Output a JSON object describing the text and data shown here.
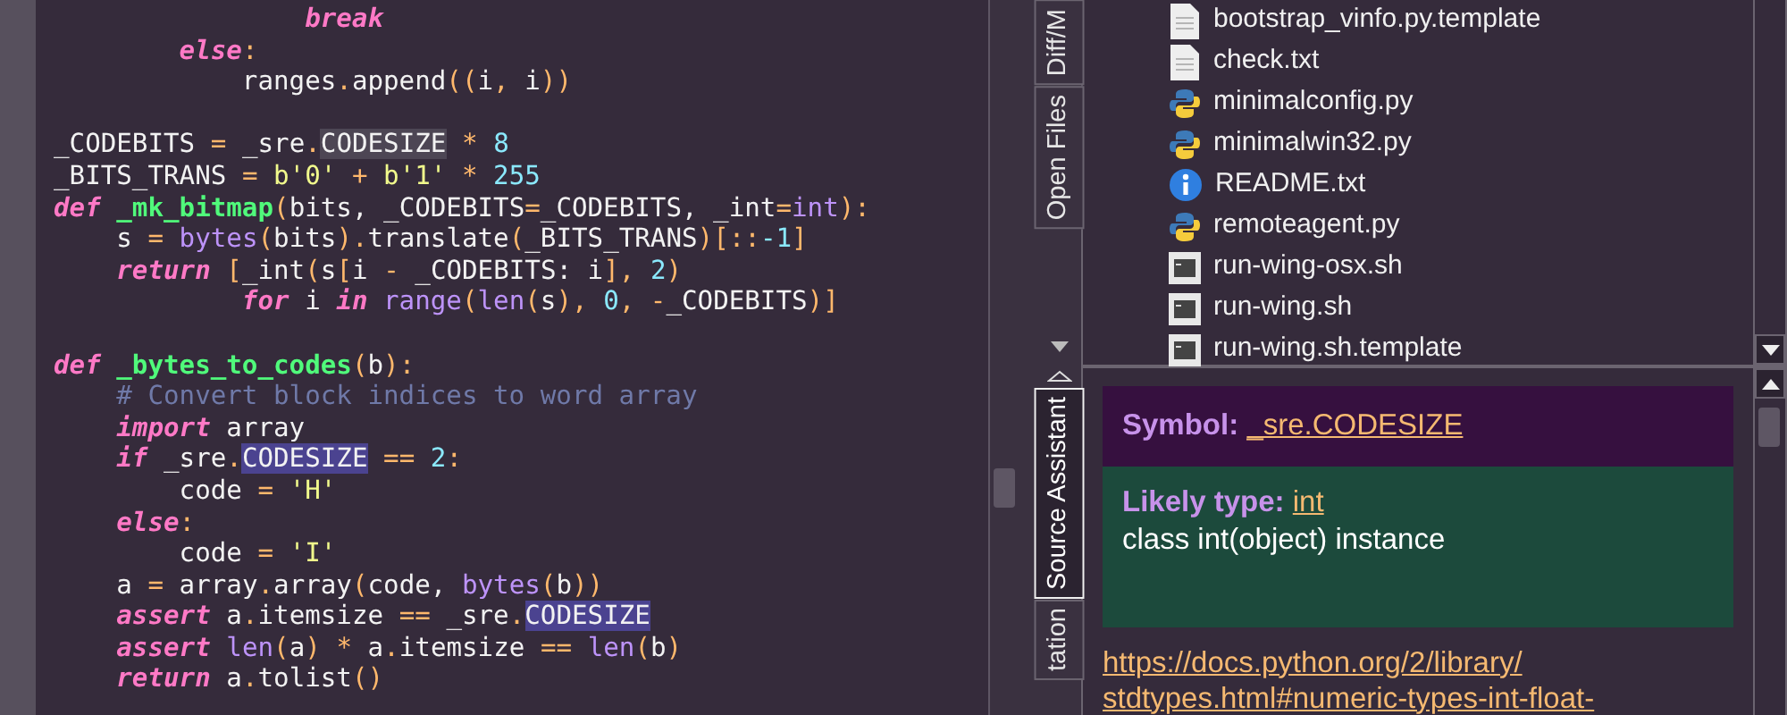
{
  "editor": {
    "blocks": [
      [
        [
          {
            "text": "                break",
            "kind": "keyword"
          }
        ],
        [
          {
            "text": "        else",
            "kind": "keyword"
          },
          {
            "text": ":",
            "kind": "operator"
          }
        ],
        [
          {
            "text": "            ranges",
            "kind": "plain"
          },
          {
            "text": ".",
            "kind": "operator"
          },
          {
            "text": "append",
            "kind": "plain"
          },
          {
            "text": "((",
            "kind": "operator"
          },
          {
            "text": "i",
            "kind": "plain"
          },
          {
            "text": ",",
            "kind": "operator"
          },
          {
            "text": " i",
            "kind": "plain"
          },
          {
            "text": "))",
            "kind": "operator"
          }
        ]
      ],
      [
        [
          {
            "text": "_CODEBITS ",
            "kind": "plain"
          },
          {
            "text": "=",
            "kind": "operator"
          },
          {
            "text": " _sre",
            "kind": "plain"
          },
          {
            "text": ".",
            "kind": "operator"
          },
          {
            "text": "CODESIZE",
            "kind": "selected"
          },
          {
            "text": " * ",
            "kind": "operator"
          },
          {
            "text": "8",
            "kind": "number"
          }
        ],
        [
          {
            "text": "_BITS_TRANS ",
            "kind": "plain"
          },
          {
            "text": "=",
            "kind": "operator"
          },
          {
            "text": " b'0'",
            "kind": "string"
          },
          {
            "text": " + ",
            "kind": "operator"
          },
          {
            "text": "b'1'",
            "kind": "string"
          },
          {
            "text": " * ",
            "kind": "operator"
          },
          {
            "text": "255",
            "kind": "number"
          }
        ],
        [
          {
            "text": "def",
            "kind": "keyword"
          },
          {
            "text": " _mk_bitmap",
            "kind": "function"
          },
          {
            "text": "(",
            "kind": "operator"
          },
          {
            "text": "bits, _CODEBITS",
            "kind": "plain"
          },
          {
            "text": "=",
            "kind": "operator"
          },
          {
            "text": "_CODEBITS, _int",
            "kind": "plain"
          },
          {
            "text": "=",
            "kind": "operator"
          },
          {
            "text": "int",
            "kind": "builtin"
          },
          {
            "text": "):",
            "kind": "operator"
          }
        ],
        [
          {
            "text": "    s ",
            "kind": "plain"
          },
          {
            "text": "=",
            "kind": "operator"
          },
          {
            "text": " bytes",
            "kind": "builtin"
          },
          {
            "text": "(",
            "kind": "operator"
          },
          {
            "text": "bits",
            "kind": "plain"
          },
          {
            "text": ").",
            "kind": "operator"
          },
          {
            "text": "translate",
            "kind": "plain"
          },
          {
            "text": "(",
            "kind": "operator"
          },
          {
            "text": "_BITS_TRANS",
            "kind": "plain"
          },
          {
            "text": ")[::",
            "kind": "operator"
          },
          {
            "text": "-1",
            "kind": "number"
          },
          {
            "text": "]",
            "kind": "operator"
          }
        ],
        [
          {
            "text": "    return",
            "kind": "keyword"
          },
          {
            "text": " [",
            "kind": "operator"
          },
          {
            "text": "_int",
            "kind": "plain"
          },
          {
            "text": "(",
            "kind": "operator"
          },
          {
            "text": "s",
            "kind": "plain"
          },
          {
            "text": "[",
            "kind": "operator"
          },
          {
            "text": "i ",
            "kind": "plain"
          },
          {
            "text": "-",
            "kind": "operator"
          },
          {
            "text": " _CODEBITS: i",
            "kind": "plain"
          },
          {
            "text": "],",
            "kind": "operator"
          },
          {
            "text": " 2",
            "kind": "number"
          },
          {
            "text": ")",
            "kind": "operator"
          }
        ],
        [
          {
            "text": "            for",
            "kind": "keyword"
          },
          {
            "text": " i ",
            "kind": "plain"
          },
          {
            "text": "in",
            "kind": "keyword"
          },
          {
            "text": " range",
            "kind": "builtin"
          },
          {
            "text": "(",
            "kind": "operator"
          },
          {
            "text": "len",
            "kind": "builtin"
          },
          {
            "text": "(",
            "kind": "operator"
          },
          {
            "text": "s",
            "kind": "plain"
          },
          {
            "text": "),",
            "kind": "operator"
          },
          {
            "text": " 0",
            "kind": "number"
          },
          {
            "text": ", -",
            "kind": "operator"
          },
          {
            "text": "_CODEBITS",
            "kind": "plain"
          },
          {
            "text": ")]",
            "kind": "operator"
          }
        ]
      ],
      [
        [
          {
            "text": "def",
            "kind": "keyword"
          },
          {
            "text": " _bytes_to_codes",
            "kind": "function"
          },
          {
            "text": "(",
            "kind": "operator"
          },
          {
            "text": "b",
            "kind": "plain"
          },
          {
            "text": "):",
            "kind": "operator"
          }
        ],
        [
          {
            "text": "    # Convert block indices to word array",
            "kind": "comment"
          }
        ],
        [
          {
            "text": "    import",
            "kind": "keyword"
          },
          {
            "text": " array",
            "kind": "plain"
          }
        ],
        [
          {
            "text": "    if",
            "kind": "keyword"
          },
          {
            "text": " _sre",
            "kind": "plain"
          },
          {
            "text": ".",
            "kind": "operator"
          },
          {
            "text": "CODESIZE",
            "kind": "occurrence"
          },
          {
            "text": " == ",
            "kind": "operator"
          },
          {
            "text": "2",
            "kind": "number"
          },
          {
            "text": ":",
            "kind": "operator"
          }
        ],
        [
          {
            "text": "        code ",
            "kind": "plain"
          },
          {
            "text": "=",
            "kind": "operator"
          },
          {
            "text": " 'H'",
            "kind": "string"
          }
        ],
        [
          {
            "text": "    else",
            "kind": "keyword"
          },
          {
            "text": ":",
            "kind": "operator"
          }
        ],
        [
          {
            "text": "        code ",
            "kind": "plain"
          },
          {
            "text": "=",
            "kind": "operator"
          },
          {
            "text": " 'I'",
            "kind": "string"
          }
        ],
        [
          {
            "text": "    a ",
            "kind": "plain"
          },
          {
            "text": "=",
            "kind": "operator"
          },
          {
            "text": " array",
            "kind": "plain"
          },
          {
            "text": ".",
            "kind": "operator"
          },
          {
            "text": "array",
            "kind": "plain"
          },
          {
            "text": "(",
            "kind": "operator"
          },
          {
            "text": "code, ",
            "kind": "plain"
          },
          {
            "text": "bytes",
            "kind": "builtin"
          },
          {
            "text": "(",
            "kind": "operator"
          },
          {
            "text": "b",
            "kind": "plain"
          },
          {
            "text": "))",
            "kind": "operator"
          }
        ],
        [
          {
            "text": "    assert",
            "kind": "keyword"
          },
          {
            "text": " a",
            "kind": "plain"
          },
          {
            "text": ".",
            "kind": "operator"
          },
          {
            "text": "itemsize ",
            "kind": "plain"
          },
          {
            "text": "==",
            "kind": "operator"
          },
          {
            "text": " _sre",
            "kind": "plain"
          },
          {
            "text": ".",
            "kind": "operator"
          },
          {
            "text": "CODESIZE",
            "kind": "occurrence"
          }
        ],
        [
          {
            "text": "    assert",
            "kind": "keyword"
          },
          {
            "text": " len",
            "kind": "builtin"
          },
          {
            "text": "(",
            "kind": "operator"
          },
          {
            "text": "a",
            "kind": "plain"
          },
          {
            "text": ")",
            "kind": "operator"
          },
          {
            "text": " * ",
            "kind": "operator"
          },
          {
            "text": "a",
            "kind": "plain"
          },
          {
            "text": ".",
            "kind": "operator"
          },
          {
            "text": "itemsize ",
            "kind": "plain"
          },
          {
            "text": "==",
            "kind": "operator"
          },
          {
            "text": " len",
            "kind": "builtin"
          },
          {
            "text": "(",
            "kind": "operator"
          },
          {
            "text": "b",
            "kind": "plain"
          },
          {
            "text": ")",
            "kind": "operator"
          }
        ],
        [
          {
            "text": "    return",
            "kind": "keyword"
          },
          {
            "text": " a",
            "kind": "plain"
          },
          {
            "text": ".",
            "kind": "operator"
          },
          {
            "text": "tolist",
            "kind": "plain"
          },
          {
            "text": "()",
            "kind": "operator"
          }
        ]
      ]
    ]
  },
  "top_tabs": [
    {
      "label": "Diff/M",
      "selected": false
    },
    {
      "label": "Open Files",
      "selected": false
    }
  ],
  "files": [
    {
      "name": "bootstrap_vinfo.py.template",
      "kind": "document"
    },
    {
      "name": "check.txt",
      "kind": "document"
    },
    {
      "name": "minimalconfig.py",
      "kind": "python"
    },
    {
      "name": "minimalwin32.py",
      "kind": "python"
    },
    {
      "name": "README.txt",
      "kind": "info"
    },
    {
      "name": "remoteagent.py",
      "kind": "python"
    },
    {
      "name": "run-wing-osx.sh",
      "kind": "terminal"
    },
    {
      "name": "run-wing.sh",
      "kind": "terminal"
    },
    {
      "name": "run-wing.sh.template",
      "kind": "terminal"
    }
  ],
  "bottom_tabs": [
    {
      "label": "Source Assistant",
      "selected": true
    },
    {
      "label": "tation",
      "selected": false
    }
  ],
  "source_assistant": {
    "symbol_label": "Symbol:",
    "symbol": "_sre.CODESIZE",
    "type_label": "Likely type:",
    "type": "int",
    "description": "class int(object) instance",
    "link_lines": [
      "https://docs.python.org/2/library/",
      "stdtypes.html#numeric-types-int-float-"
    ]
  }
}
